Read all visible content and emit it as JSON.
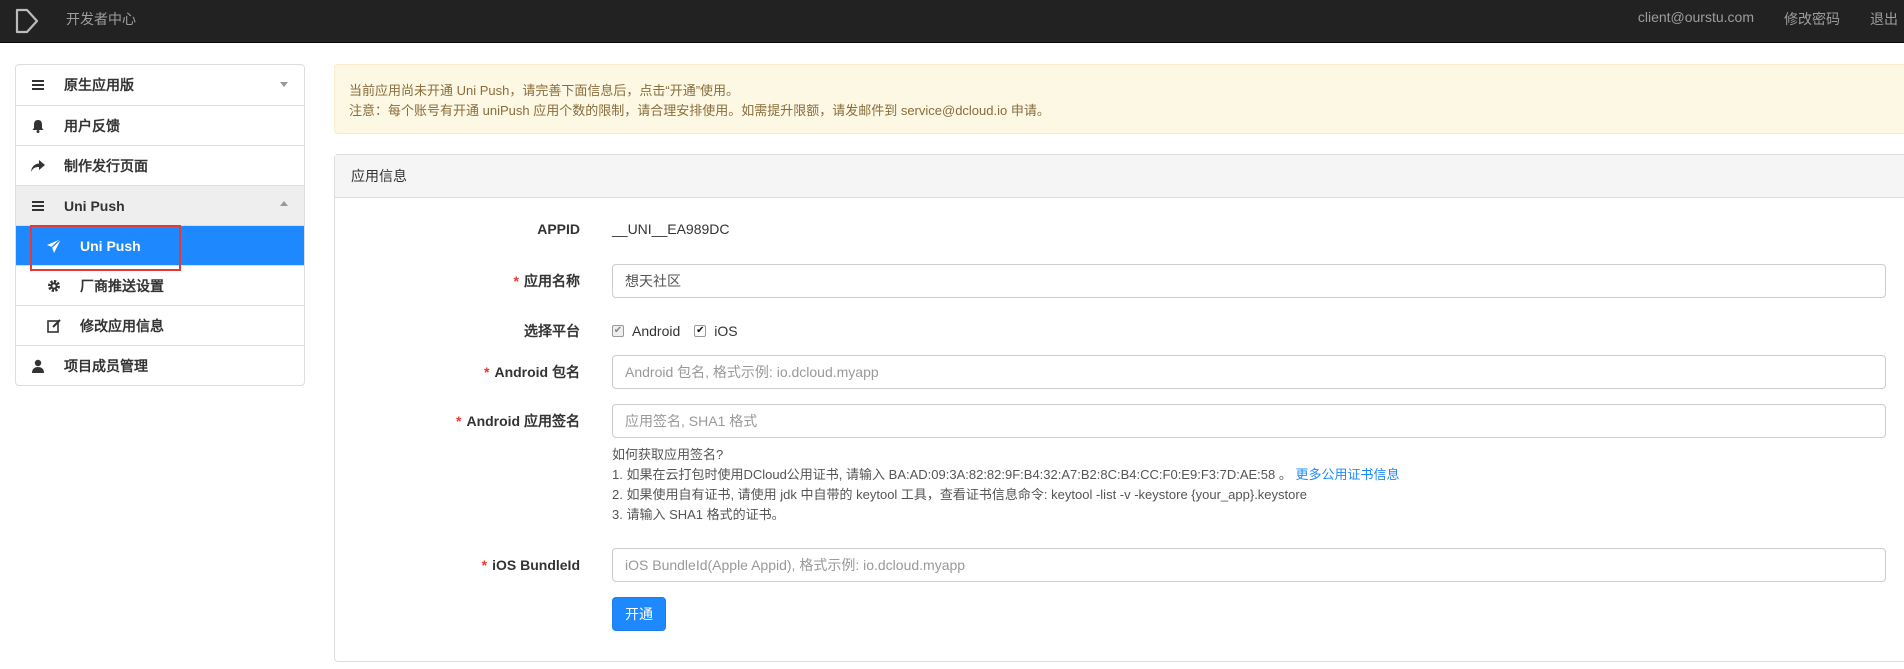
{
  "topbar": {
    "brand": "开发者中心",
    "email": "client@ourstu.com",
    "change_password": "修改密码",
    "logout": "退出"
  },
  "sidebar": {
    "items": [
      {
        "label": "原生应用版",
        "icon": "list-icon"
      },
      {
        "label": "用户反馈",
        "icon": "bell-icon"
      },
      {
        "label": "制作发行页面",
        "icon": "share-icon"
      },
      {
        "label": "Uni Push",
        "icon": "list-icon"
      },
      {
        "label": "Uni Push",
        "icon": "send-icon"
      },
      {
        "label": "厂商推送设置",
        "icon": "gear-icon"
      },
      {
        "label": "修改应用信息",
        "icon": "edit-icon"
      },
      {
        "label": "项目成员管理",
        "icon": "user-icon"
      }
    ],
    "active_color": "#1e88ff"
  },
  "alert": {
    "line1": "当前应用尚未开通 Uni Push，请完善下面信息后，点击“开通”使用。",
    "line2": "注意：每个账号有开通 uniPush 应用个数的限制，请合理安排使用。如需提升限额，请发邮件到 service@dcloud.io 申请。"
  },
  "panel": {
    "title": "应用信息",
    "appid_label": "APPID",
    "appid_value": "__UNI__EA989DC",
    "app_name_label": "应用名称",
    "app_name_value": "想天社区",
    "platform_label": "选择平台",
    "platform_android": "Android",
    "platform_ios": "iOS",
    "android_pkg_label": "Android 包名",
    "android_pkg_placeholder": "Android 包名, 格式示例: io.dcloud.myapp",
    "android_sig_label": "Android 应用签名",
    "android_sig_placeholder": "应用签名, SHA1 格式",
    "help_title": "如何获取应用签名?",
    "help_1": "1. 如果在云打包时使用DCloud公用证书, 请输入 BA:AD:09:3A:82:82:9F:B4:32:A7:B2:8C:B4:CC:F0:E9:F3:7D:AE:58 。",
    "help_1_link": "更多公用证书信息",
    "help_2": "2. 如果使用自有证书, 请使用 jdk 中自带的 keytool 工具，查看证书信息命令: keytool -list -v -keystore {your_app}.keystore",
    "help_3": "3. 请输入 SHA1 格式的证书。",
    "ios_bundle_label": "iOS BundleId",
    "ios_bundle_placeholder": "iOS BundleId(Apple Appid), 格式示例: io.dcloud.myapp",
    "submit_label": "开通",
    "required_mark": "*"
  }
}
